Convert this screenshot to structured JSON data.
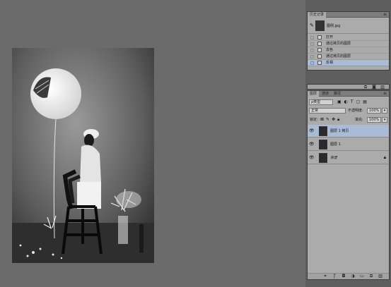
{
  "history": {
    "tabs": [
      "历史记录"
    ],
    "snapshot_label": "图例.jpg",
    "items": [
      {
        "label": "打开",
        "selected": false
      },
      {
        "label": "通过拷贝的图层",
        "selected": false
      },
      {
        "label": "去色",
        "selected": false
      },
      {
        "label": "通过拷贝的图层",
        "selected": false
      },
      {
        "label": "反相",
        "selected": true
      }
    ]
  },
  "layers": {
    "tabs": [
      "图层",
      "通道",
      "路径"
    ],
    "filter_kind": "ρ类型",
    "blend_mode": "正常",
    "opacity_label": "不透明度:",
    "opacity_value": "100%",
    "lock_label": "锁定:",
    "fill_label": "填充:",
    "fill_value": "100%",
    "items": [
      {
        "name": "图层 1 拷贝",
        "selected": true
      },
      {
        "name": "图层 1",
        "selected": false
      },
      {
        "name": "背景",
        "selected": false
      }
    ]
  },
  "icons": {
    "history_brush": "history-brush-icon",
    "panel_menu": "panel-menu-icon",
    "eye": "eye-icon",
    "lock": "lock-icon"
  },
  "colors": {
    "selection": "#a9bcd7",
    "canvas": "#6b6b6b",
    "panel": "#ababab"
  }
}
